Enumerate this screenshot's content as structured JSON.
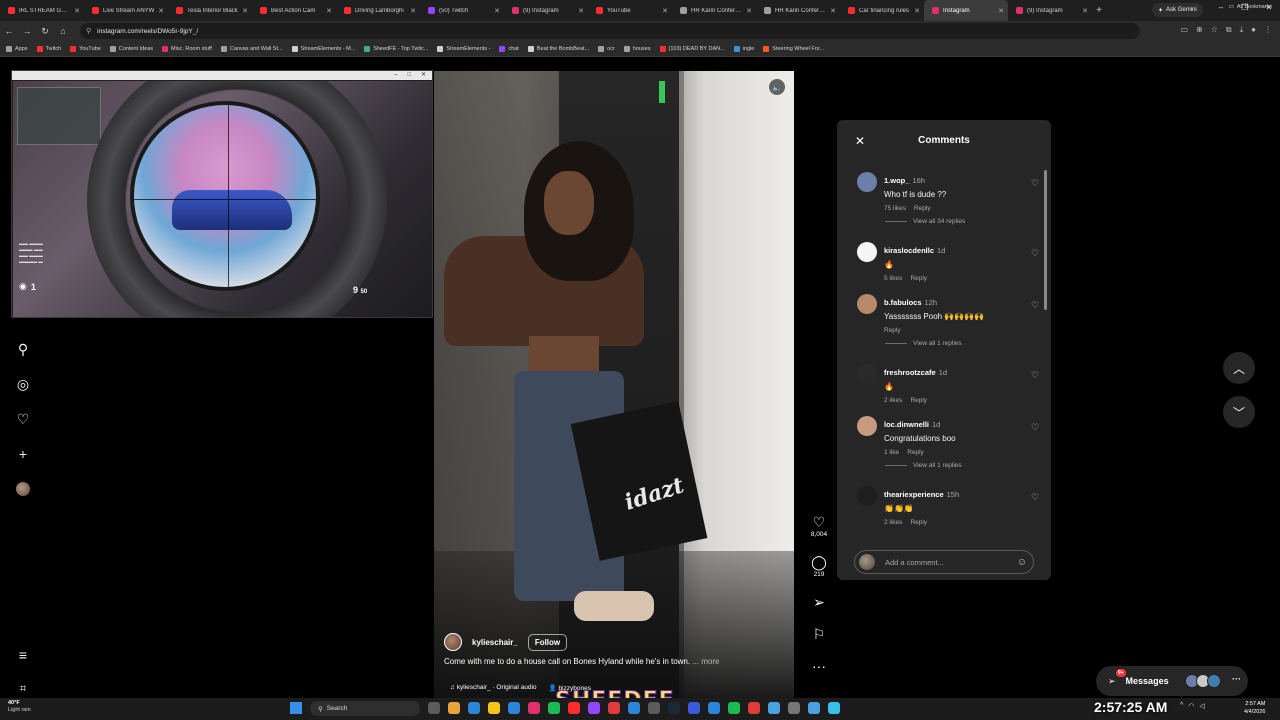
{
  "browser": {
    "tabs": [
      {
        "label": "IRL STREAM GO P",
        "color": "#ff2d2d"
      },
      {
        "label": "Live Stream ANYW",
        "color": "#ff2d2d"
      },
      {
        "label": "Tesla Interior Black",
        "color": "#ff2d2d"
      },
      {
        "label": "Best Action Cam",
        "color": "#ff2d2d"
      },
      {
        "label": "Driving Lamborghi",
        "color": "#ff2d2d"
      },
      {
        "label": "(50) Twitch",
        "color": "#9146ff"
      },
      {
        "label": "(9) Instagram",
        "color": "#e1306c"
      },
      {
        "label": "YouTube",
        "color": "#ff2d2d"
      },
      {
        "label": "HR Karin Conference",
        "color": "#9aa0a6"
      },
      {
        "label": "HR Karin Conference",
        "color": "#9aa0a6"
      },
      {
        "label": "Car financing rules",
        "color": "#ff2d2d"
      },
      {
        "label": "Instagram",
        "color": "#e1306c",
        "active": true
      },
      {
        "label": "(9) Instagram",
        "color": "#e1306c"
      }
    ],
    "ask_gemini": "Ask Gemini",
    "url": "instagram.com/reels/DWo5r-9jpY_/",
    "bookmarks": [
      {
        "label": "Apps",
        "color": "#9aa0a6"
      },
      {
        "label": "Twitch",
        "color": "#ff2d2d"
      },
      {
        "label": "YouTube",
        "color": "#ff2d2d"
      },
      {
        "label": "Content Ideas",
        "color": "#9aa0a6"
      },
      {
        "label": "Misc. Room stuff",
        "color": "#e1306c"
      },
      {
        "label": "Canvas and Wall St...",
        "color": "#9aa0a6"
      },
      {
        "label": "StreamElements - M...",
        "color": "#cfcfcf"
      },
      {
        "label": "SheedFE - Top Twitc...",
        "color": "#36b37e"
      },
      {
        "label": "StreamElements -",
        "color": "#cfcfcf"
      },
      {
        "label": "chat",
        "color": "#9146ff"
      },
      {
        "label": "Beat the BombBeat...",
        "color": "#cfcfcf"
      },
      {
        "label": "ocr",
        "color": "#9aa0a6"
      },
      {
        "label": "houses",
        "color": "#9aa0a6"
      },
      {
        "label": "(103) DEAD BY DAN...",
        "color": "#ff2d2d"
      },
      {
        "label": "ingle",
        "color": "#3a8fe8"
      },
      {
        "label": "Steering Wheel For...",
        "color": "#ff5722"
      }
    ],
    "all_bookmarks": "All Bookmarks"
  },
  "game_overlay": {
    "hud_left_count": "1",
    "hud_right_ammo": "9",
    "hud_right_reserve": "50"
  },
  "reel": {
    "username": "kylieschair_",
    "follow_label": "Follow",
    "caption": "Come with me to do a house call on Bones Hyland while he's in town.",
    "more_label": "... more",
    "audio": "kylieschair_ · Original audio",
    "tagged_user": "bizzybones",
    "bag_text": "idazt",
    "likes": "8,004",
    "comments_count": "219"
  },
  "comments_panel": {
    "title": "Comments",
    "input_placeholder": "Add a comment...",
    "comments": [
      {
        "user": "1.wop_",
        "time": "16h",
        "text": "Who tf is dude ??",
        "likes": "75 likes",
        "reply": "Reply",
        "view_replies": "View all 34 replies",
        "avatar": "#6b7fa8"
      },
      {
        "user": "kiraslocdenllc",
        "time": "1d",
        "text": "🔥",
        "likes": "5 likes",
        "reply": "Reply",
        "view_replies": "",
        "avatar": "#f5f5f5"
      },
      {
        "user": "b.fabulocs",
        "time": "12h",
        "text": "Yasssssss Pooh 🙌🙌🙌🙌",
        "likes": "",
        "reply": "Reply",
        "view_replies": "View all 1 replies",
        "avatar": "#b8896b"
      },
      {
        "user": "freshrootzcafe",
        "time": "1d",
        "text": "🔥",
        "likes": "2 likes",
        "reply": "Reply",
        "view_replies": "",
        "avatar": "#2a2a2a"
      },
      {
        "user": "loc.dinwnelli",
        "time": "1d",
        "text": "Congratulations boo",
        "likes": "1 like",
        "reply": "Reply",
        "view_replies": "View all 1 replies",
        "avatar": "#c99a82"
      },
      {
        "user": "theariexperience",
        "time": "15h",
        "text": "👏👏👏",
        "likes": "2 likes",
        "reply": "Reply",
        "view_replies": "",
        "avatar": "#1e1e1e"
      }
    ]
  },
  "messages": {
    "label": "Messages",
    "badge": "9+"
  },
  "overlay_brand": "SHEEDFE",
  "taskbar": {
    "temp": "40°F",
    "condition": "Light rain",
    "search": "Search",
    "time_big": "2:57:25 AM",
    "time_small": "2:57 AM",
    "date_small": "4/4/2026"
  }
}
